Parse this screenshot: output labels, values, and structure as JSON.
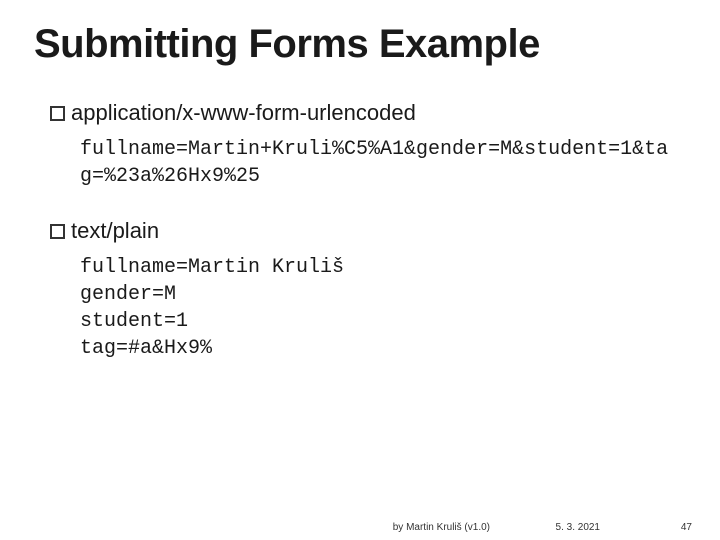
{
  "title": "Submitting Forms Example",
  "section1": {
    "label": "application/x-www-form-urlencoded",
    "code": "fullname=Martin+Kruli%C5%A1&gender=M&student=1&tag=%23a%26Hx9%25"
  },
  "section2": {
    "label": "text/plain",
    "code": "fullname=Martin Kruliš\ngender=M\nstudent=1\ntag=#a&Hx9%"
  },
  "footer": {
    "author": "by Martin Kruliš (v1.0)",
    "date": "5. 3. 2021",
    "page": "47"
  }
}
